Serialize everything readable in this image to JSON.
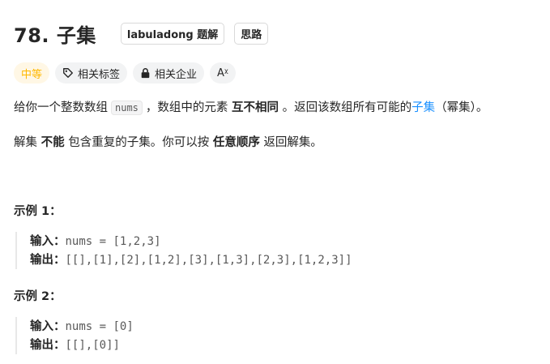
{
  "problem": {
    "title": "78. 子集",
    "tag1": "labuladong 题解",
    "tag2": "思路"
  },
  "chips": {
    "difficulty": "中等",
    "related_tags": "相关标签",
    "related_companies": "相关企业",
    "font_toggle": "Aᵡ"
  },
  "description": {
    "p1_a": "给你一个整数数组",
    "p1_code": "nums",
    "p1_b": "，数组中的元素",
    "p1_bold": "互不相同",
    "p1_c": "。返回该数组所有可能的",
    "p1_link": "子集",
    "p1_d": "（幂集）。",
    "p2_a": "解集",
    "p2_bold1": "不能",
    "p2_b": "包含重复的子集。你可以按",
    "p2_bold2": "任意顺序",
    "p2_c": "返回解集。"
  },
  "examples": [
    {
      "title": "示例 1：",
      "input_label": "输入：",
      "input": "nums = [1,2,3]",
      "output_label": "输出：",
      "output": "[[],[1],[2],[1,2],[3],[1,3],[2,3],[1,2,3]]"
    },
    {
      "title": "示例 2：",
      "input_label": "输入：",
      "input": "nums = [0]",
      "output_label": "输出：",
      "output": "[[],[0]]"
    }
  ],
  "colors": {
    "difficulty": "#ffb800",
    "link": "#1a90ff",
    "text": "#262626",
    "code": "#595959"
  },
  "icons": [
    "tag-icon",
    "lock-icon",
    "font-size-icon"
  ]
}
